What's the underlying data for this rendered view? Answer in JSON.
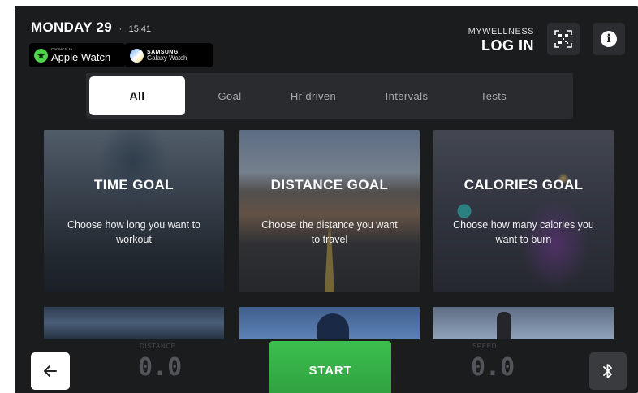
{
  "header": {
    "date": "MONDAY 29",
    "separator": "·",
    "time": "15:41",
    "apple_watch": {
      "small": "Connects to",
      "label": "Apple Watch"
    },
    "samsung": {
      "brand": "SAMSUNG",
      "label": "Galaxy Watch"
    },
    "mywellness": "MYWELLNESS",
    "login": "LOG IN",
    "icons": {
      "qr": "qr-code-icon",
      "info": "info-icon"
    }
  },
  "tabs": [
    {
      "label": "All",
      "active": true
    },
    {
      "label": "Goal",
      "active": false
    },
    {
      "label": "Hr driven",
      "active": false
    },
    {
      "label": "Intervals",
      "active": false
    },
    {
      "label": "Tests",
      "active": false
    }
  ],
  "cards": [
    {
      "title": "TIME GOAL",
      "description": "Choose how long you want to workout"
    },
    {
      "title": "DISTANCE GOAL",
      "description": "Choose the distance you want to travel"
    },
    {
      "title": "CALORIES GOAL",
      "description": "Choose how many calories you want to burn"
    }
  ],
  "bottom": {
    "distance": {
      "label": "DISTANCE",
      "value": "0.0"
    },
    "start": "START",
    "speed": {
      "label": "SPEED",
      "value": "0.0"
    },
    "icons": {
      "back": "arrow-left-icon",
      "bluetooth": "bluetooth-icon"
    }
  },
  "colors": {
    "background": "#1b1c1e",
    "start_green": "#36b148",
    "apple_green": "#4fd34b",
    "tab_bar": "#2a2b2e"
  }
}
